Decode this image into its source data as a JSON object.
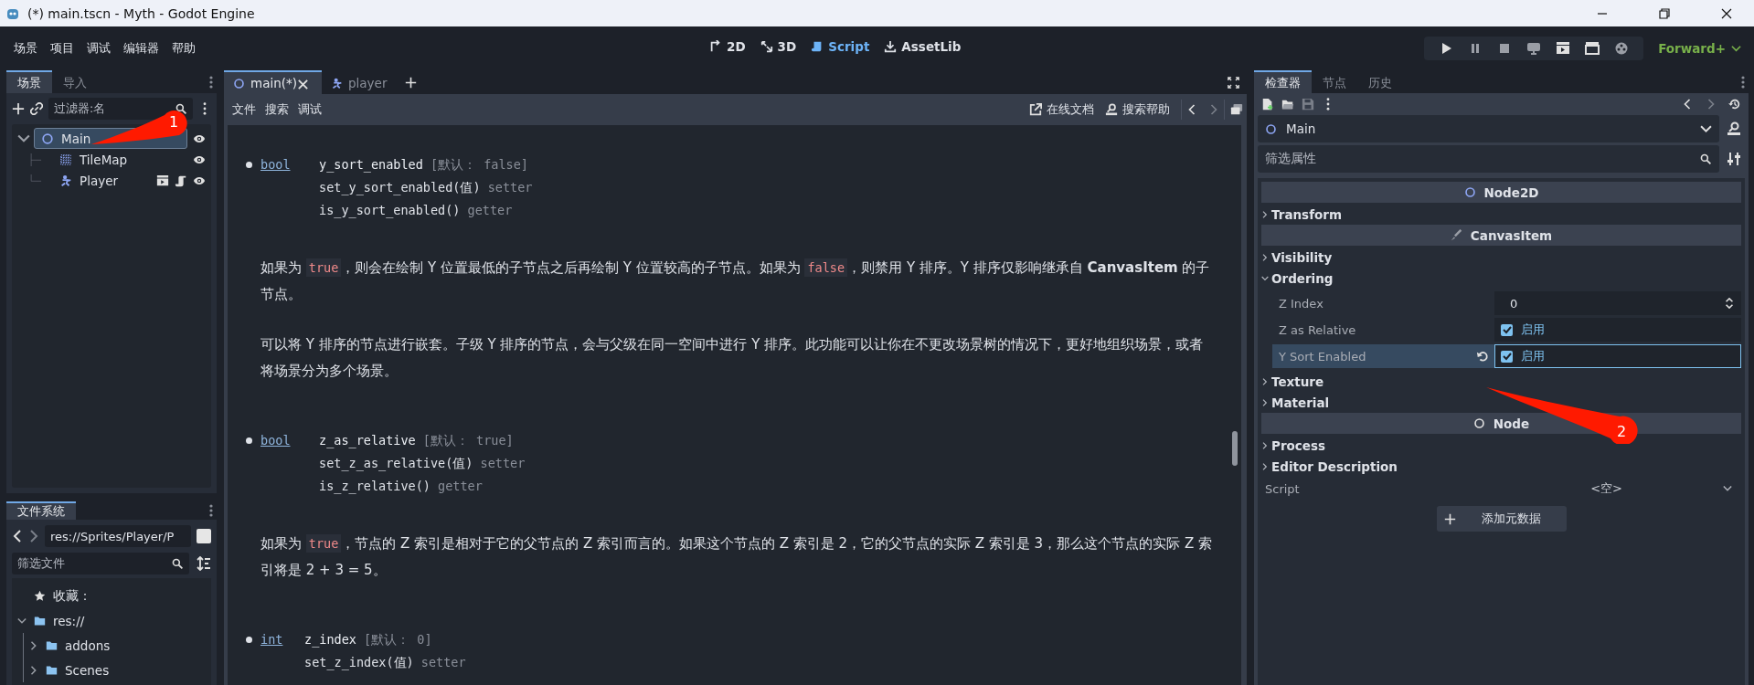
{
  "window": {
    "title": "(*) main.tscn - Myth - Godot Engine"
  },
  "menu": [
    "场景",
    "项目",
    "调试",
    "编辑器",
    "帮助"
  ],
  "workspaces": [
    {
      "label": "2D",
      "kind": "planar",
      "selected": false
    },
    {
      "label": "3D",
      "kind": "spatial",
      "selected": false
    },
    {
      "label": "Script",
      "kind": "script",
      "selected": true
    },
    {
      "label": "AssetLib",
      "kind": "assetlib",
      "selected": false
    }
  ],
  "renderer": "Forward+",
  "scene_dock": {
    "tabs": [
      {
        "label": "场景",
        "selected": true
      },
      {
        "label": "导入",
        "selected": false
      }
    ],
    "filter": {
      "placeholder": "过滤器:名"
    },
    "tree": [
      {
        "name": "Main",
        "kind": "node2d",
        "selected": true,
        "expanded": true,
        "instanced": false,
        "scripted": false,
        "children": [
          {
            "name": "TileMap",
            "kind": "tilemap",
            "selected": false,
            "instanced": false,
            "scripted": false
          },
          {
            "name": "Player",
            "kind": "character",
            "selected": false,
            "instanced": true,
            "scripted": true
          }
        ]
      }
    ]
  },
  "filesystem_dock": {
    "tabs": [
      {
        "label": "文件系统",
        "selected": true
      }
    ],
    "path": "res://Sprites/Player/P",
    "filter": {
      "placeholder": "筛选文件"
    },
    "tree": [
      {
        "label": "收藏：",
        "kind": "favorites"
      },
      {
        "label": "res://",
        "kind": "folder",
        "expanded": true,
        "children": [
          {
            "label": "addons",
            "kind": "folder",
            "expanded": false
          },
          {
            "label": "Scenes",
            "kind": "folder",
            "expanded": false
          }
        ]
      }
    ]
  },
  "script_editor": {
    "tabs": [
      {
        "label": "main(*)",
        "kind": "scene",
        "selected": true
      },
      {
        "label": "player",
        "kind": "character",
        "selected": false
      }
    ],
    "menu": [
      "文件",
      "搜索",
      "调试"
    ],
    "links": [
      {
        "label": "在线文档",
        "kind": "online-docs"
      },
      {
        "label": "搜索帮助",
        "kind": "search-help"
      }
    ],
    "doc": [
      {
        "kind": "property",
        "type": "bool",
        "name": "y_sort_enabled",
        "default": "[默认： false]",
        "accessors": [
          {
            "call": "set_y_sort_enabled(值)",
            "role": "setter"
          },
          {
            "call": "is_y_sort_enabled()",
            "role": "getter"
          }
        ]
      },
      {
        "kind": "paragraph",
        "segments": [
          {
            "kind": "text",
            "text": "如果为 "
          },
          {
            "kind": "code",
            "text": "true"
          },
          {
            "kind": "text",
            "text": "，则会在绘制 Y 位置最低的子节点之后再绘制 Y 位置较高的子节点。如果为 "
          },
          {
            "kind": "code",
            "text": "false"
          },
          {
            "kind": "text",
            "text": "，则禁用 Y 排序。Y 排序仅影响继承自 "
          },
          {
            "kind": "bold",
            "text": "CanvasItem"
          },
          {
            "kind": "text",
            "text": " 的子节点。"
          }
        ]
      },
      {
        "kind": "paragraph",
        "segments": [
          {
            "kind": "text",
            "text": "可以将 Y 排序的节点进行嵌套。子级 Y 排序的节点，会与父级在同一空间中进行 Y 排序。此功能可以让你在不更改场景树的情况下，更好地组织场景，或者将场景分为多个场景。"
          }
        ]
      },
      {
        "kind": "property",
        "type": "bool",
        "name": "z_as_relative",
        "default": "[默认： true]",
        "accessors": [
          {
            "call": "set_z_as_relative(值)",
            "role": "setter"
          },
          {
            "call": "is_z_relative()",
            "role": "getter"
          }
        ]
      },
      {
        "kind": "paragraph",
        "segments": [
          {
            "kind": "text",
            "text": "如果为 "
          },
          {
            "kind": "code",
            "text": "true"
          },
          {
            "kind": "text",
            "text": "，节点的 Z 索引是相对于它的父节点的 Z 索引而言的。如果这个节点的 Z 索引是 2，它的父节点的实际 Z 索引是 3，那么这个节点的实际 Z 索引将是 2 + 3 = 5。"
          }
        ]
      },
      {
        "kind": "property",
        "type": "int",
        "name": "z_index",
        "default": "[默认： 0]",
        "accessors": [
          {
            "call": "set_z_index(值)",
            "role": "setter"
          }
        ]
      }
    ]
  },
  "inspector": {
    "tabs": [
      {
        "label": "检查器",
        "selected": true
      },
      {
        "label": "节点",
        "selected": false
      },
      {
        "label": "历史",
        "selected": false
      }
    ],
    "object": {
      "name": "Main"
    },
    "filter": {
      "placeholder": "筛选属性"
    },
    "items": [
      {
        "kind": "category",
        "label": "Node2D"
      },
      {
        "kind": "group",
        "label": "Transform",
        "expanded": false
      },
      {
        "kind": "category",
        "label": "CanvasItem"
      },
      {
        "kind": "group",
        "label": "Visibility",
        "expanded": false
      },
      {
        "kind": "group",
        "label": "Ordering",
        "expanded": true,
        "children": [
          {
            "kind": "number",
            "label": "Z Index",
            "value": "0",
            "selected": false
          },
          {
            "kind": "check",
            "label": "Z as Relative",
            "checked": true,
            "value": "启用",
            "selected": false
          },
          {
            "kind": "check",
            "label": "Y Sort Enabled",
            "checked": true,
            "value": "启用",
            "selected": true
          }
        ]
      },
      {
        "kind": "group",
        "label": "Texture",
        "expanded": false
      },
      {
        "kind": "group",
        "label": "Material",
        "expanded": false
      },
      {
        "kind": "category",
        "label": "Node"
      },
      {
        "kind": "group",
        "label": "Process",
        "expanded": false
      },
      {
        "kind": "group",
        "label": "Editor Description",
        "expanded": false
      }
    ],
    "script": {
      "label": "Script",
      "value": "<空>"
    },
    "add_button": "添加元数据"
  },
  "annotations": [
    {
      "label": "1"
    },
    {
      "label": "2"
    }
  ]
}
